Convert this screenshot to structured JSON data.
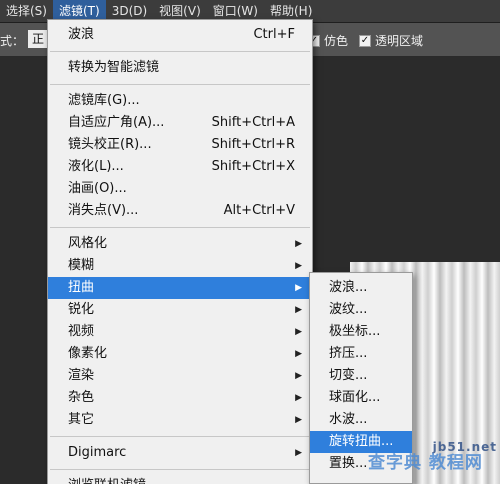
{
  "menubar": {
    "items": [
      {
        "label": "选择(S)"
      },
      {
        "label": "滤镜(T)",
        "active": true
      },
      {
        "label": "3D(D)"
      },
      {
        "label": "视图(V)"
      },
      {
        "label": "窗口(W)"
      },
      {
        "label": "帮助(H)"
      }
    ]
  },
  "options": {
    "mode_label": "式：",
    "mode_value": "正",
    "checkbox1_label": "仿色",
    "checkbox2_label": "透明区域",
    "checkbox1_checked": true,
    "checkbox2_checked": true
  },
  "filter_menu": {
    "items": [
      {
        "label": "波浪",
        "shortcut": "Ctrl+F"
      },
      {
        "label": "转换为智能滤镜"
      },
      {
        "label": "滤镜库(G)..."
      },
      {
        "label": "自适应广角(A)...",
        "shortcut": "Shift+Ctrl+A"
      },
      {
        "label": "镜头校正(R)...",
        "shortcut": "Shift+Ctrl+R"
      },
      {
        "label": "液化(L)...",
        "shortcut": "Shift+Ctrl+X"
      },
      {
        "label": "油画(O)..."
      },
      {
        "label": "消失点(V)...",
        "shortcut": "Alt+Ctrl+V"
      },
      {
        "label": "风格化",
        "submenu": true
      },
      {
        "label": "模糊",
        "submenu": true
      },
      {
        "label": "扭曲",
        "submenu": true,
        "highlighted": true
      },
      {
        "label": "锐化",
        "submenu": true
      },
      {
        "label": "视频",
        "submenu": true
      },
      {
        "label": "像素化",
        "submenu": true
      },
      {
        "label": "渲染",
        "submenu": true
      },
      {
        "label": "杂色",
        "submenu": true
      },
      {
        "label": "其它",
        "submenu": true
      },
      {
        "label": "Digimarc",
        "submenu": true
      },
      {
        "label": "浏览联机滤镜..."
      }
    ]
  },
  "distort_submenu": {
    "items": [
      {
        "label": "波浪..."
      },
      {
        "label": "波纹..."
      },
      {
        "label": "极坐标..."
      },
      {
        "label": "挤压..."
      },
      {
        "label": "切变..."
      },
      {
        "label": "球面化..."
      },
      {
        "label": "水波..."
      },
      {
        "label": "旋转扭曲...",
        "highlighted": true
      },
      {
        "label": "置换..."
      }
    ]
  },
  "watermark": {
    "text": "查字典 教程网",
    "site": "jb51.net"
  },
  "colors": {
    "highlight": "#2f7fdc",
    "menu_bg": "#f0f0f0",
    "menubar_bg": "#3c3c3c"
  }
}
